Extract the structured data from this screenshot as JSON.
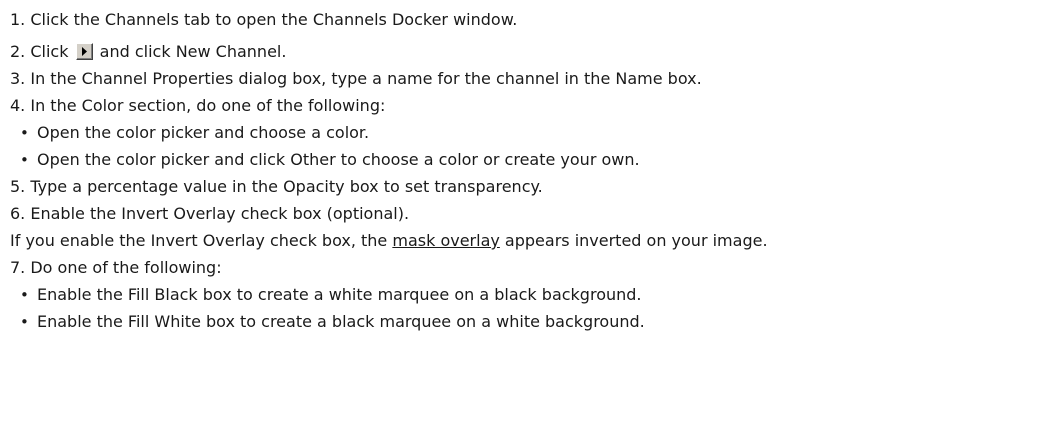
{
  "steps": [
    {
      "num": "1.",
      "text": "Click the Channels tab to open the Channels Docker window."
    },
    {
      "num": "2.",
      "text_before": "Click ",
      "icon": "flyout-arrow-icon",
      "text_after": " and click New Channel."
    },
    {
      "num": "3.",
      "text": "In the Channel Properties dialog box, type a name for the channel in the Name box."
    },
    {
      "num": "4.",
      "text": "In the Color section, do one of the following:",
      "bullets": [
        "Open the color picker and choose a color.",
        "Open the color picker and click Other to choose a color or create your own."
      ]
    },
    {
      "num": "5.",
      "text": "Type a percentage value in the Opacity box to set transparency."
    },
    {
      "num": "6.",
      "text": "Enable the Invert Overlay check box (optional).",
      "note": {
        "before": "If you enable the Invert Overlay check box, the ",
        "link": "mask overlay",
        "after": " appears inverted on your image."
      }
    },
    {
      "num": "7.",
      "text": "Do one of the following:",
      "bullets": [
        "Enable the Fill Black box to create a white marquee on a black background.",
        "Enable the Fill White box to create a black marquee on a white background."
      ]
    }
  ],
  "bullet_glyph": "•"
}
